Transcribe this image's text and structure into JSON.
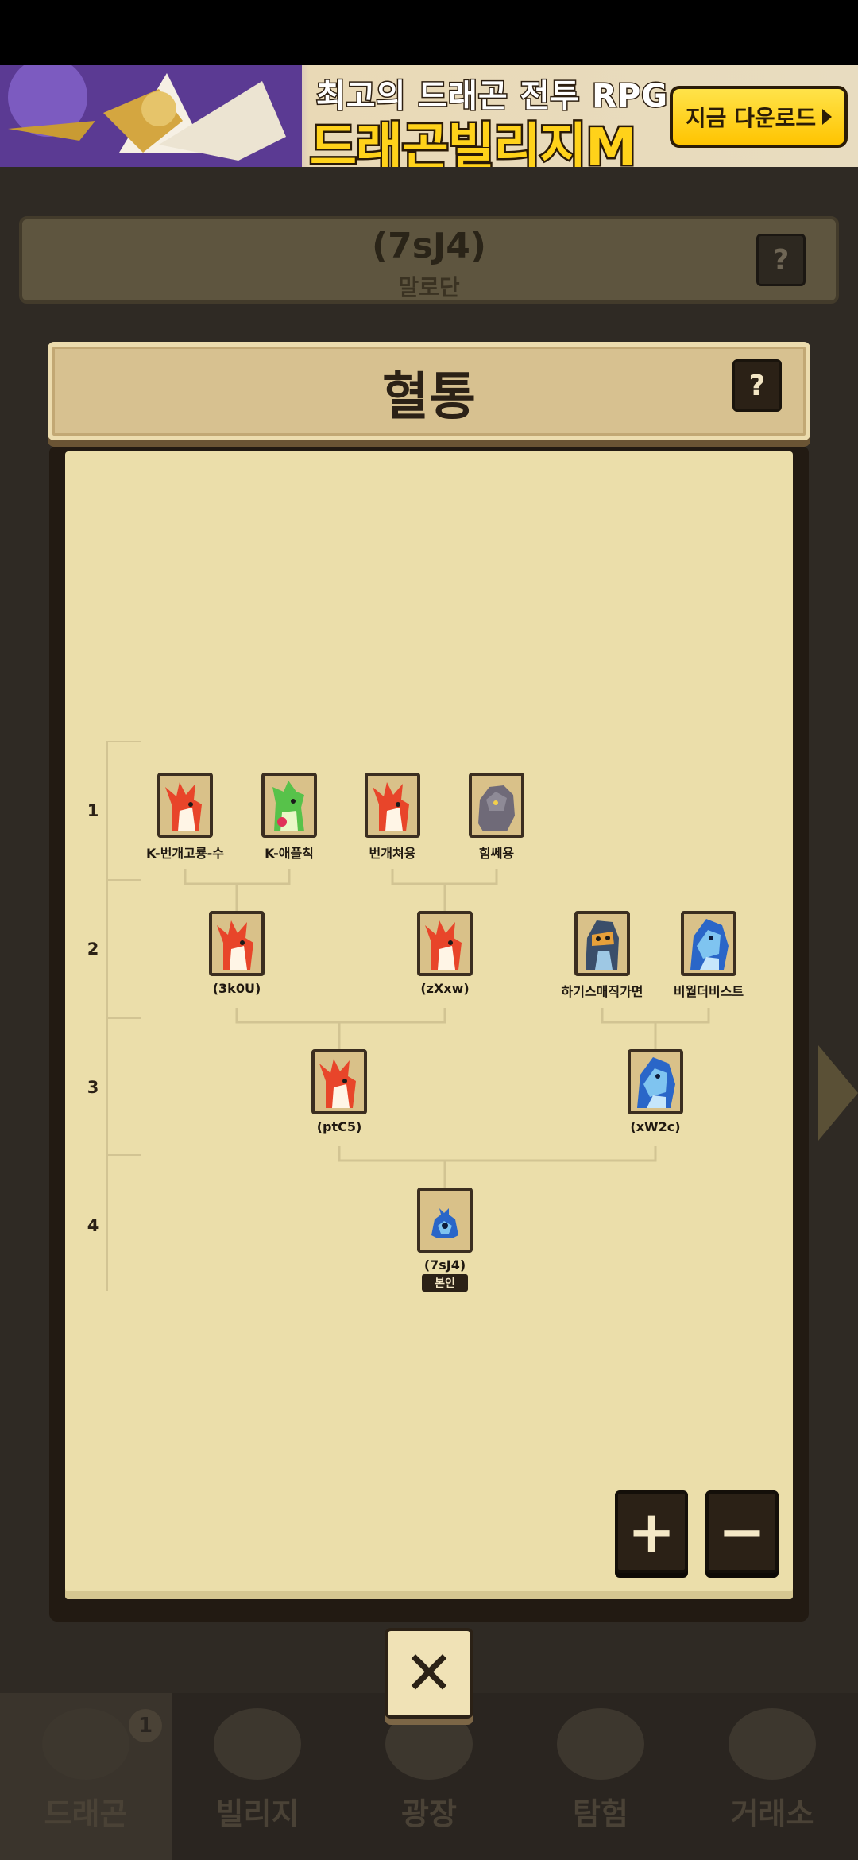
{
  "ad": {
    "tagline": "최고의 드래곤 전투 RPG",
    "title": "드래곤빌리지M",
    "cta": "지금 다운로드"
  },
  "background": {
    "header_title": "(7sJ4)",
    "header_sub": "말로단",
    "help": "?",
    "nav": [
      {
        "label": "드래곤",
        "badge": "1"
      },
      {
        "label": "빌리지"
      },
      {
        "label": "광장"
      },
      {
        "label": "탐험"
      },
      {
        "label": "거래소"
      }
    ]
  },
  "modal": {
    "title": "혈통",
    "help": "?",
    "zoom_in": "+",
    "zoom_out": "−",
    "close": "✕"
  },
  "tree": {
    "generations": [
      "1",
      "2",
      "3",
      "4"
    ],
    "nodes": [
      {
        "label": "K-번개고룡-수",
        "icon": "red-dragon",
        "gen": 1
      },
      {
        "label": "K-애플칙",
        "icon": "green-dragon",
        "gen": 1
      },
      {
        "label": "번개쳐용",
        "icon": "red-dragon",
        "gen": 1
      },
      {
        "label": "힘쎄용",
        "icon": "gray-dragon",
        "gen": 1
      },
      {
        "label": "(3k0U)",
        "icon": "red-dragon",
        "gen": 2
      },
      {
        "label": "(zXxw)",
        "icon": "red-dragon",
        "gen": 2
      },
      {
        "label": "하기스매직가면",
        "icon": "masked-dragon",
        "gen": 2
      },
      {
        "label": "비월더비스트",
        "icon": "blue-dragon",
        "gen": 2
      },
      {
        "label": "(ptC5)",
        "icon": "red-dragon",
        "gen": 3
      },
      {
        "label": "(xW2c)",
        "icon": "blue-dragon",
        "gen": 3
      },
      {
        "label": "(7sJ4)",
        "icon": "blue-egg",
        "gen": 4,
        "badge": "본인"
      }
    ]
  }
}
